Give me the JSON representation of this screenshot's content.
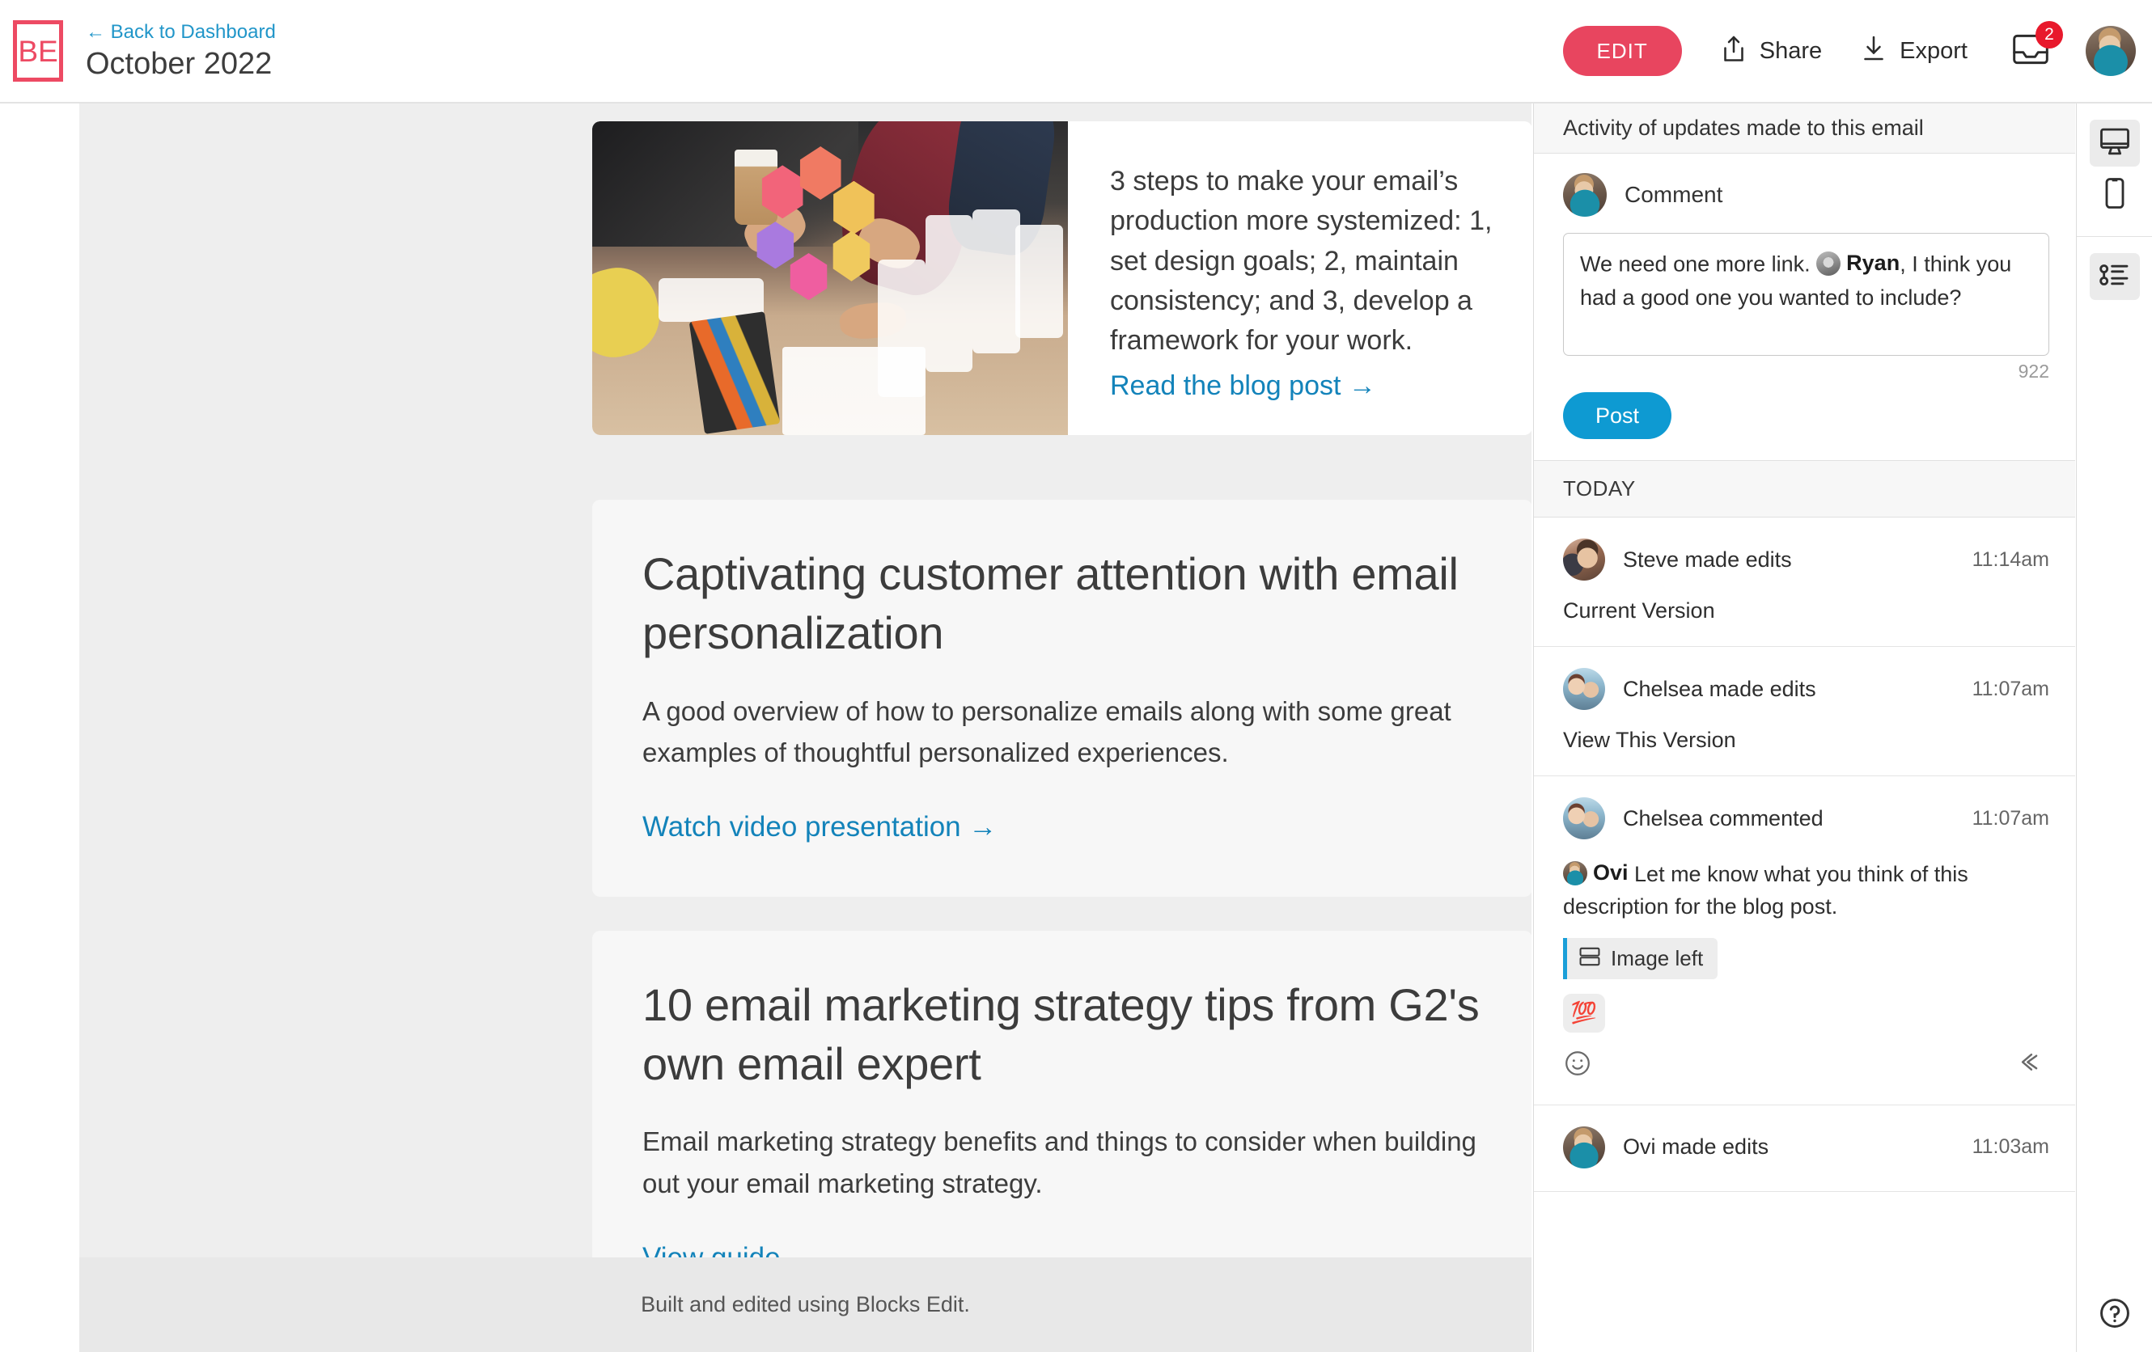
{
  "header": {
    "logo_text": "BE",
    "back_link": "← Back to Dashboard",
    "doc_title": "October 2022",
    "edit_label": "EDIT",
    "share_label": "Share",
    "export_label": "Export",
    "inbox_badge": "2",
    "share_icon": "share-upload-icon",
    "export_icon": "download-icon",
    "inbox_icon": "inbox-tray-icon",
    "avatar_icon": "user-avatar",
    "accent_color": "#e8455f",
    "link_color": "#2196c9"
  },
  "email": {
    "blocks": [
      {
        "type": "image-left",
        "image_alt": "design thinking workshop table with UI mockups",
        "body": "3 steps to make your email’s production more systemized: 1, set design goals; 2, maintain consistency; and 3, develop a framework for your work.",
        "cta": "Read the blog post →"
      },
      {
        "type": "text",
        "heading": "Captivating customer attention with email personalization",
        "body": "A good overview of how to personalize emails along with some great examples of thoughtful personalized experiences.",
        "cta": "Watch video presentation →"
      },
      {
        "type": "text",
        "heading": "10 email marketing strategy tips from G2's own email expert",
        "body": "Email marketing strategy benefits and things to consider when building out your email marketing strategy.",
        "cta": "View guide →"
      }
    ],
    "footer": "Built and edited using Blocks Edit."
  },
  "sidebar": {
    "title": "Activity of updates made to this email",
    "compose": {
      "label": "Comment",
      "avatar_icon": "user-avatar-ovi",
      "text_before_mention": "We need one more link. ",
      "mention": "Ryan",
      "mention_avatar_icon": "user-avatar-ryan",
      "text_after_mention": ", I think you had a good one you wanted to include?",
      "char_count": "922",
      "post_label": "Post"
    },
    "day_label": "TODAY",
    "items": [
      {
        "avatar": "av-steve",
        "avatar_icon": "user-avatar-steve",
        "who": "Steve made edits",
        "time": "11:14am",
        "sub": "Current Version",
        "comment": null,
        "tag": null,
        "reaction": null
      },
      {
        "avatar": "av-chelsea",
        "avatar_icon": "user-avatar-chelsea",
        "who": "Chelsea made edits",
        "time": "11:07am",
        "sub": "View This Version",
        "comment": null,
        "tag": null,
        "reaction": null
      },
      {
        "avatar": "av-chelsea",
        "avatar_icon": "user-avatar-chelsea",
        "who": "Chelsea commented",
        "time": "11:07am",
        "sub": null,
        "comment_mention": "Ovi",
        "comment": " Let me know what you think of this description for the blog post.",
        "comment_avatar_icon": "user-avatar-ovi",
        "tag": "Image left",
        "tag_icon": "image-left-layout-icon",
        "reaction": "💯",
        "add_reaction_icon": "smiley-face-icon",
        "reply_icon": "reply-arrow-icon"
      },
      {
        "avatar": "av-ovi",
        "avatar_icon": "user-avatar-ovi",
        "who": "Ovi made edits",
        "time": "11:03am",
        "sub": null,
        "comment": null,
        "tag": null,
        "reaction": null
      }
    ]
  },
  "rail": {
    "desktop_icon": "desktop-monitor-icon",
    "mobile_icon": "mobile-phone-icon",
    "activity_icon": "activity-timeline-icon",
    "help_icon": "question-mark-circle-icon"
  }
}
